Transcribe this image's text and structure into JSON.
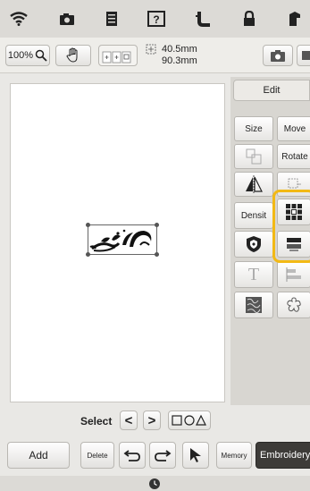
{
  "toolbar": {
    "zoom_label": "100%",
    "size_width": "40.5mm",
    "size_height": "90.3mm"
  },
  "panel": {
    "edit_tab": "Edit",
    "size_label": "Size",
    "move_label": "Move",
    "rotate_label": "Rotate",
    "density_label": "Densit",
    "text_icon": "T"
  },
  "select_bar": {
    "label": "Select",
    "prev": "<",
    "next": ">"
  },
  "bottom": {
    "add_label": "Add",
    "delete_label": "Delete",
    "memory_label": "Memory",
    "embroidery_label": "Embroidery"
  },
  "icons": {
    "wifi": "wifi-icon",
    "camera": "camera-icon",
    "document": "document-icon",
    "help": "help-icon",
    "thread": "thread-icon",
    "lock": "lock-icon",
    "machine": "machine-icon"
  }
}
